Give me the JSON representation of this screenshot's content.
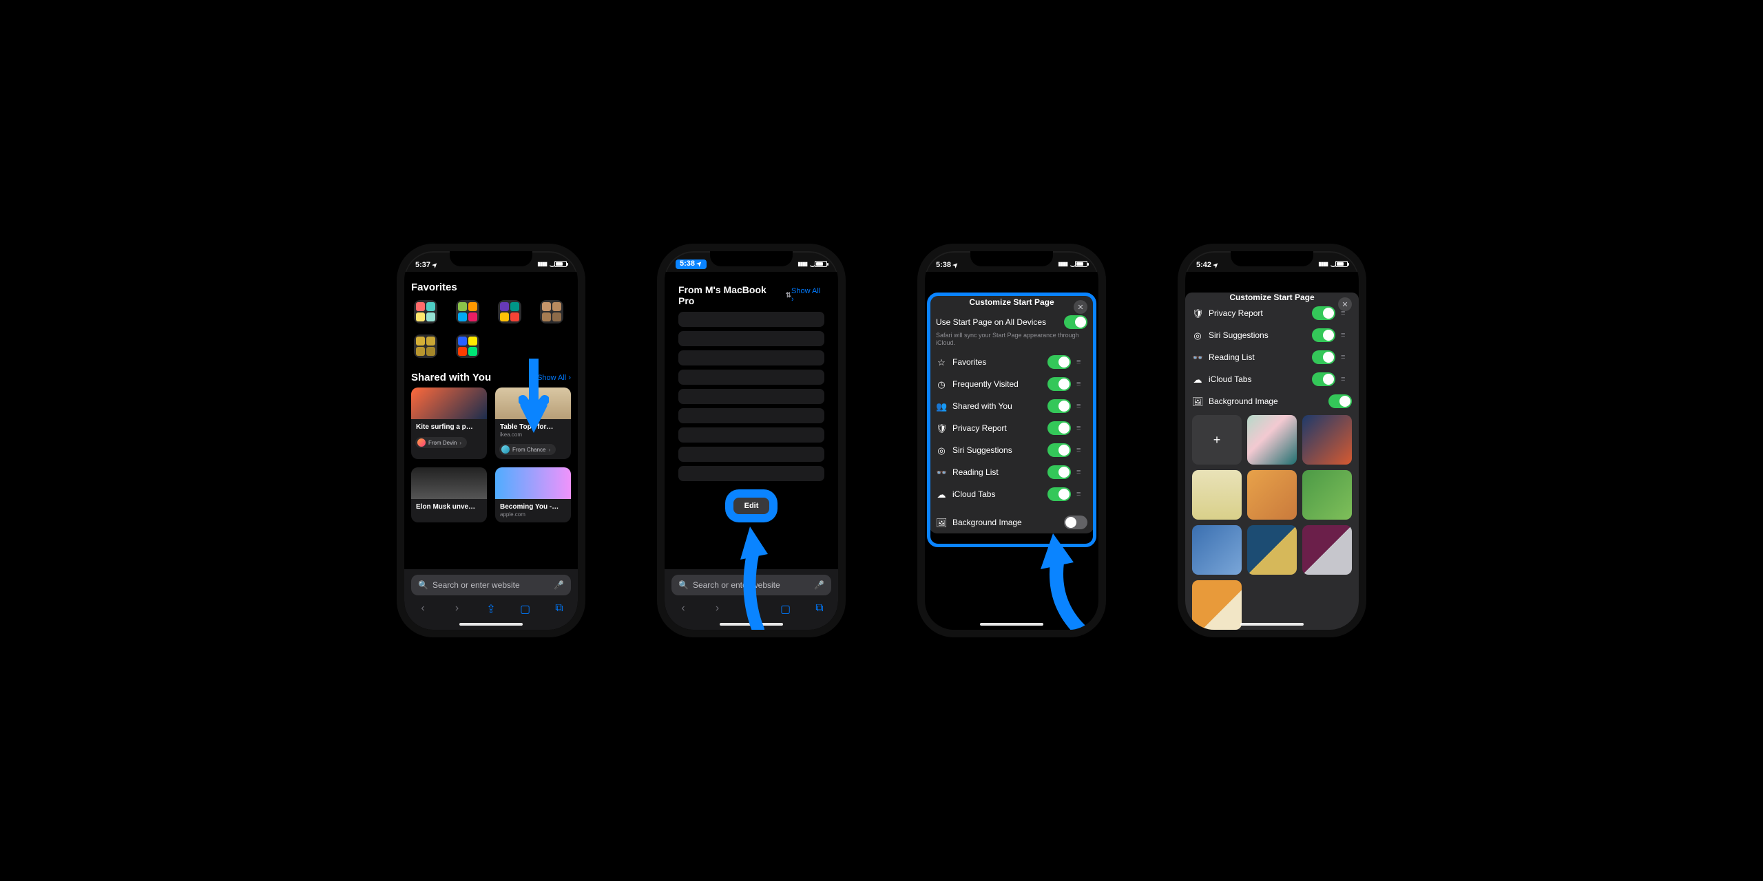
{
  "screens": {
    "s1": {
      "time": "5:37",
      "favorites_title": "Favorites",
      "shared_title": "Shared with You",
      "showall": "Show All",
      "cards": [
        {
          "title": "Kite surfing a p…",
          "sub": "",
          "from": "From Devin"
        },
        {
          "title": "Table Tops for…",
          "sub": "ikea.com",
          "from": "From Chance"
        },
        {
          "title": "Elon Musk unve…",
          "sub": "",
          "from": ""
        },
        {
          "title": "Becoming You -…",
          "sub": "apple.com",
          "from": ""
        }
      ],
      "search_ph": "Search or enter website"
    },
    "s2": {
      "time": "5:38",
      "mac_title": "From M's MacBook Pro",
      "showall": "Show All",
      "edit": "Edit",
      "search_ph": "Search or enter website"
    },
    "s3": {
      "time": "5:38",
      "sheet_title": "Customize Start Page",
      "sync_label": "Use Start Page on All Devices",
      "sync_hint": "Safari will sync your Start Page appearance through iCloud.",
      "rows": [
        {
          "icon": "star",
          "label": "Favorites",
          "on": true
        },
        {
          "icon": "clock",
          "label": "Frequently Visited",
          "on": true
        },
        {
          "icon": "people",
          "label": "Shared with You",
          "on": true
        },
        {
          "icon": "shield",
          "label": "Privacy Report",
          "on": true
        },
        {
          "icon": "siri",
          "label": "Siri Suggestions",
          "on": true
        },
        {
          "icon": "glasses",
          "label": "Reading List",
          "on": true
        },
        {
          "icon": "cloud",
          "label": "iCloud Tabs",
          "on": true
        }
      ],
      "bg_label": "Background Image",
      "bg_on": false
    },
    "s4": {
      "time": "5:42",
      "sheet_title": "Customize Start Page",
      "rows": [
        {
          "icon": "shield",
          "label": "Privacy Report",
          "on": true
        },
        {
          "icon": "siri",
          "label": "Siri Suggestions",
          "on": true
        },
        {
          "icon": "glasses",
          "label": "Reading List",
          "on": true
        },
        {
          "icon": "cloud",
          "label": "iCloud Tabs",
          "on": true
        }
      ],
      "bg_label": "Background Image",
      "bg_on": true,
      "tiles": [
        "add",
        "linear-gradient(135deg,#b5d9c9,#f3c9d1 40%,#1f6f6f)",
        "linear-gradient(135deg,#1d3a6b,#d65a31)",
        "linear-gradient(180deg,#e9e2b8,#d9d08a)",
        "linear-gradient(135deg,#e8a24a,#c97a3c)",
        "linear-gradient(135deg,#4c9a46,#7fbf5a)",
        "linear-gradient(135deg,#3a6fb0,#7aa6d8)",
        "linear-gradient(135deg,#1c4c73 50%,#d6b85a 50%)",
        "linear-gradient(135deg,#6b1f4a 50%,#c6c6cc 50%)",
        "linear-gradient(135deg,#e89a3a 60%,#f2e6c6 60%)"
      ]
    }
  },
  "close_glyph": "✕",
  "chevron_glyph": "›"
}
